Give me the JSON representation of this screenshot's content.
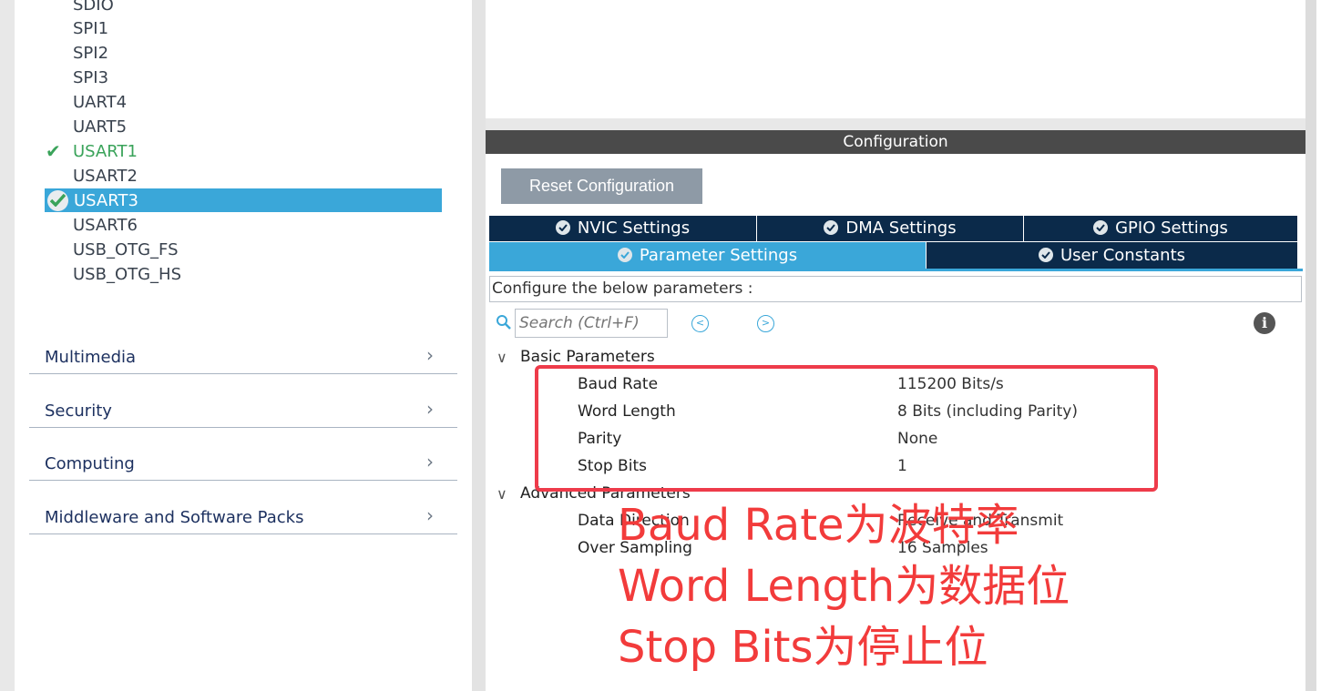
{
  "sidebar": {
    "peripherals": [
      {
        "label": "SDIO",
        "state": "normal"
      },
      {
        "label": "SPI1",
        "state": "normal"
      },
      {
        "label": "SPI2",
        "state": "normal"
      },
      {
        "label": "SPI3",
        "state": "normal"
      },
      {
        "label": "UART4",
        "state": "normal"
      },
      {
        "label": "UART5",
        "state": "normal"
      },
      {
        "label": "USART1",
        "state": "configured"
      },
      {
        "label": "USART2",
        "state": "normal"
      },
      {
        "label": "USART3",
        "state": "selected"
      },
      {
        "label": "USART6",
        "state": "normal"
      },
      {
        "label": "USB_OTG_FS",
        "state": "normal"
      },
      {
        "label": "USB_OTG_HS",
        "state": "normal"
      }
    ],
    "categories": [
      {
        "label": "Multimedia"
      },
      {
        "label": "Security"
      },
      {
        "label": "Computing"
      },
      {
        "label": "Middleware and Software Packs"
      }
    ]
  },
  "config": {
    "header": "Configuration",
    "reset_label": "Reset Configuration",
    "tabs_row1": [
      {
        "label": "NVIC Settings"
      },
      {
        "label": "DMA Settings"
      },
      {
        "label": "GPIO Settings"
      }
    ],
    "tabs_row2": [
      {
        "label": "Parameter Settings",
        "active": true
      },
      {
        "label": "User Constants",
        "active": false
      }
    ],
    "configure_text": "Configure the below parameters :",
    "search_placeholder": "Search (Ctrl+F)",
    "groups": [
      {
        "label": "Basic Parameters",
        "params": [
          {
            "name": "Baud Rate",
            "value": "115200 Bits/s"
          },
          {
            "name": "Word Length",
            "value": "8 Bits (including Parity)"
          },
          {
            "name": "Parity",
            "value": "None"
          },
          {
            "name": "Stop Bits",
            "value": "1"
          }
        ]
      },
      {
        "label": "Advanced Parameters",
        "params": [
          {
            "name": "Data Direction",
            "value": "Receive and Transmit"
          },
          {
            "name": "Over Sampling",
            "value": "16 Samples"
          }
        ]
      }
    ]
  },
  "annotations": [
    "Baud Rate为波特率",
    "Word Length为数据位",
    "Stop Bits为停止位"
  ],
  "colors": {
    "accent": "#3aa7d9",
    "tab_dark": "#0b2a4a",
    "configured_green": "#3aa35a",
    "annotation_red": "#f23b3b"
  }
}
